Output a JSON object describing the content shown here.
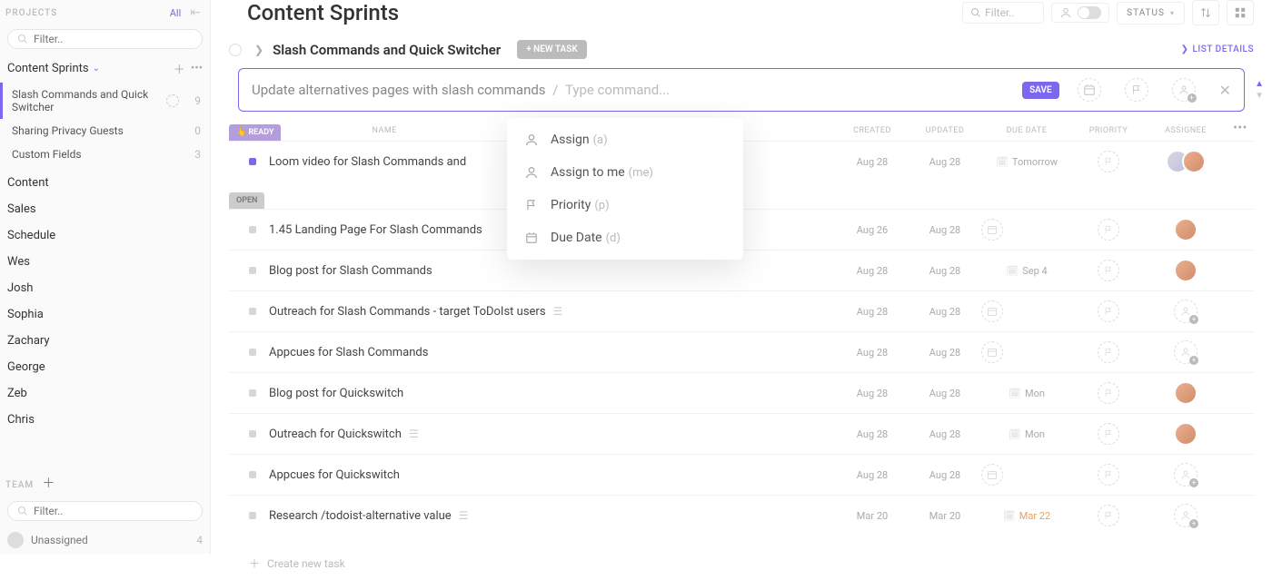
{
  "sidebar": {
    "projects_label": "PROJECTS",
    "all_label": "All",
    "filter_placeholder": "Filter..",
    "group_title": "Content Sprints",
    "projects": [
      {
        "title": "Slash Commands and Quick Switcher",
        "count": "9",
        "active": true,
        "refresh": true
      },
      {
        "title": "Sharing Privacy Guests",
        "count": "0",
        "active": false
      },
      {
        "title": "Custom Fields",
        "count": "3",
        "active": false
      }
    ],
    "nav_items": [
      "Content",
      "Sales",
      "Schedule",
      "Wes",
      "Josh",
      "Sophia",
      "Zachary",
      "George",
      "Zeb",
      "Chris"
    ],
    "team_label": "TEAM",
    "team_filter_placeholder": "Filter..",
    "unassigned_label": "Unassigned",
    "unassigned_count": "4"
  },
  "header": {
    "title": "Content Sprints",
    "filter_placeholder": "Filter..",
    "status_label": "STATUS"
  },
  "section": {
    "title": "Slash Commands and Quick Switcher",
    "new_task_btn": "+ NEW TASK",
    "list_details": "LIST DETAILS"
  },
  "compose": {
    "typed": "Update alternatives pages with slash commands",
    "hint": "Type command...",
    "save": "SAVE"
  },
  "dropdown": {
    "items": [
      {
        "icon": "user",
        "label": "Assign",
        "hint": "(a)"
      },
      {
        "icon": "user",
        "label": "Assign to me",
        "hint": "(me)"
      },
      {
        "icon": "flag",
        "label": "Priority",
        "hint": "(p)"
      },
      {
        "icon": "cal",
        "label": "Due Date",
        "hint": "(d)"
      }
    ]
  },
  "columns": {
    "name": "NAME",
    "created": "CREATED",
    "updated": "UPDATED",
    "due": "DUE DATE",
    "priority": "PRIORITY",
    "assignee": "ASSIGNEE"
  },
  "groups": [
    {
      "status_label": "👆 READY",
      "status_class": "status-ready",
      "tasks": [
        {
          "dot": "purple",
          "title": "Loom video for Slash Commands and",
          "created": "Aug 28",
          "updated": "Aug 28",
          "due": "Tomorrow",
          "due_class": "",
          "due_icon": true,
          "assignee": "group"
        }
      ]
    },
    {
      "status_label": "OPEN",
      "status_class": "status-open",
      "tasks": [
        {
          "dot": "grey",
          "title": "1.45 Landing Page For Slash Commands",
          "created": "Aug 26",
          "updated": "Aug 28",
          "due": "",
          "assignee": "avatar"
        },
        {
          "dot": "grey",
          "title": "Blog post for Slash Commands",
          "created": "Aug 28",
          "updated": "Aug 28",
          "due": "Sep 4",
          "due_icon": true,
          "assignee": "avatar"
        },
        {
          "dot": "grey",
          "title": "Outreach for Slash Commands - target ToDoIst users",
          "note": true,
          "created": "Aug 28",
          "updated": "Aug 28",
          "due": "",
          "assignee": "empty"
        },
        {
          "dot": "grey",
          "title": "Appcues for Slash Commands",
          "created": "Aug 28",
          "updated": "Aug 28",
          "due": "",
          "assignee": "empty"
        },
        {
          "dot": "grey",
          "title": "Blog post for Quickswitch",
          "created": "Aug 28",
          "updated": "Aug 28",
          "due": "Mon",
          "due_icon": true,
          "assignee": "avatar"
        },
        {
          "dot": "grey",
          "title": "Outreach for Quickswitch",
          "note": true,
          "created": "Aug 28",
          "updated": "Aug 28",
          "due": "Mon",
          "due_icon": true,
          "assignee": "avatar"
        },
        {
          "dot": "grey",
          "title": "Appcues for Quickswitch",
          "created": "Aug 28",
          "updated": "Aug 28",
          "due": "",
          "assignee": "empty"
        },
        {
          "dot": "grey",
          "title": "Research /todoist-alternative value",
          "note": true,
          "created": "Mar 20",
          "updated": "Mar 20",
          "due": "Mar 22",
          "due_class": "due-orange",
          "due_icon": true,
          "assignee": "empty"
        }
      ]
    }
  ],
  "create_task_label": "Create new task"
}
